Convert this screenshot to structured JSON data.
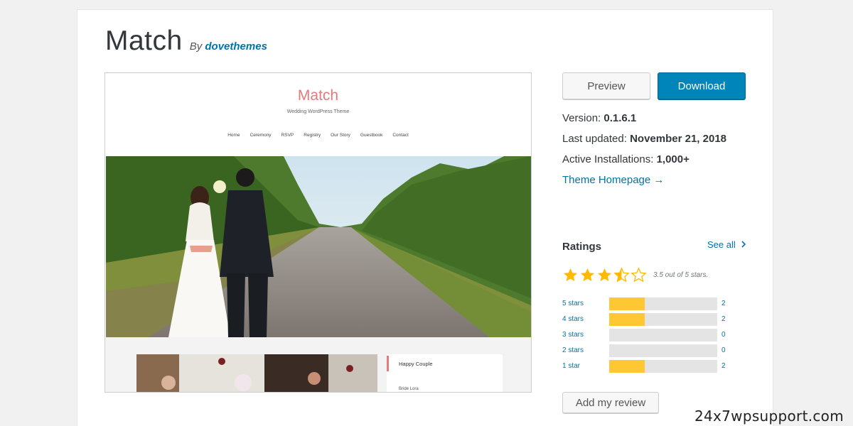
{
  "theme": {
    "name": "Match",
    "by": "By",
    "author": "dovethemes"
  },
  "screenshot": {
    "site_title": "Match",
    "site_tagline": "Wedding WordPress Theme",
    "nav": [
      "Home",
      "Ceremony",
      "RSVP",
      "Registry",
      "Our Story",
      "Guestbook",
      "Contact"
    ],
    "sidebar_heading": "Happy Couple",
    "sidebar_sub": "Bride Lora"
  },
  "actions": {
    "preview_label": "Preview",
    "download_label": "Download"
  },
  "meta": {
    "version_label": "Version:",
    "version_value": "0.1.6.1",
    "updated_label": "Last updated:",
    "updated_value": "November 21, 2018",
    "installs_label": "Active Installations:",
    "installs_value": "1,000+",
    "homepage_link": "Theme Homepage →"
  },
  "ratings": {
    "heading": "Ratings",
    "see_all": "See all",
    "average": 3.5,
    "summary": "3.5 out of 5 stars.",
    "max_count": 2,
    "rows": [
      {
        "label": "5 stars",
        "count": "2",
        "fraction": 0.33
      },
      {
        "label": "4 stars",
        "count": "2",
        "fraction": 0.33
      },
      {
        "label": "3 stars",
        "count": "0",
        "fraction": 0
      },
      {
        "label": "2 stars",
        "count": "0",
        "fraction": 0
      },
      {
        "label": "1 star",
        "count": "2",
        "fraction": 0.33
      }
    ],
    "add_review": "Add my review"
  },
  "watermark": "24x7wpsupport.com",
  "colors": {
    "accent": "#0073aa",
    "download_bg": "#0085ba",
    "star": "#ffb900",
    "bar_fill": "#ffc733",
    "site_title": "#e27b7b"
  },
  "icons": {
    "see_all_chevron": "chevron-right-icon",
    "homepage_arrow": "arrow-right-icon"
  }
}
